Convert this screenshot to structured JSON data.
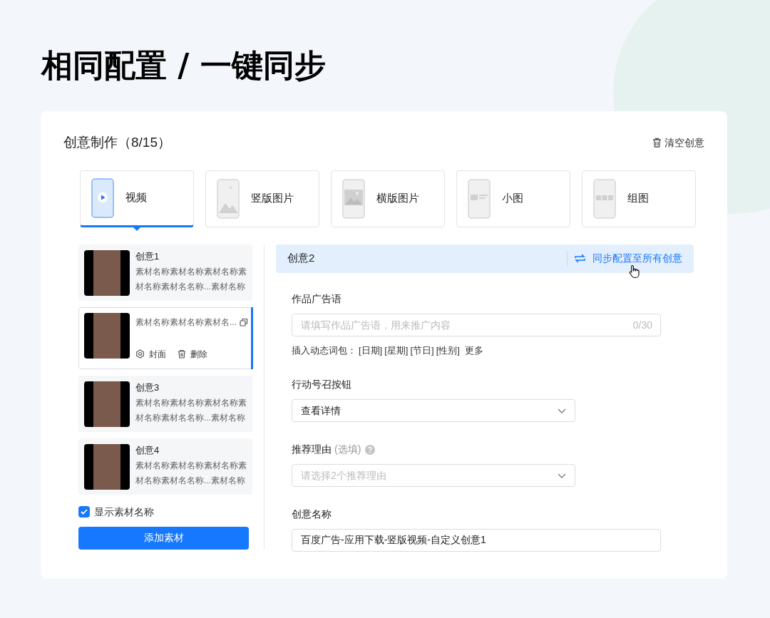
{
  "page_title": "相同配置 / 一键同步",
  "panel": {
    "title": "创意制作（8/15）",
    "clear_button": "清空创意"
  },
  "tabs": [
    {
      "label": "视频",
      "kind": "video",
      "selected": true
    },
    {
      "label": "竖版图片",
      "kind": "portrait",
      "selected": false
    },
    {
      "label": "横版图片",
      "kind": "landscape",
      "selected": false
    },
    {
      "label": "小图",
      "kind": "small",
      "selected": false
    },
    {
      "label": "组图",
      "kind": "group",
      "selected": false
    }
  ],
  "creatives": [
    {
      "title": "创意1",
      "description": "素材名称素材名称素材名称素材名称素材名名称...素材名称",
      "selected": false
    },
    {
      "description": "素材名称素材名称素材名...",
      "selected": true,
      "actions": [
        {
          "kind": "cover",
          "label": "封面"
        },
        {
          "kind": "delete",
          "label": "删除"
        }
      ]
    },
    {
      "title": "创意3",
      "description": "素材名称素材名称素材名称素材名称素材名名称...素材名称",
      "selected": false
    },
    {
      "title": "创意4",
      "description": "素材名称素材名称素材名称素材名称素材名名称...素材名称",
      "selected": false
    }
  ],
  "show_names": {
    "label": "显示素材名称",
    "checked": true
  },
  "add_button": "添加素材",
  "editor": {
    "title": "创意2",
    "sync_button": "同步配置至所有创意",
    "fields": [
      {
        "kind": "text",
        "label": "作品广告语",
        "placeholder": "请填写作品广告语，用来推广内容",
        "counter": "0/30",
        "insert_label": "插入动态词包：",
        "tokens": [
          "[日期]",
          "[星期]",
          "[节日]",
          "[性别]"
        ],
        "more": "更多"
      },
      {
        "kind": "select",
        "label": "行动号召按钮",
        "value": "查看详情"
      },
      {
        "kind": "select",
        "label": "推荐理由",
        "optional": "(选填)",
        "placeholder": "请选择2个推荐理由"
      },
      {
        "kind": "text",
        "label": "创意名称",
        "value": "百度广告-应用下载-竖版视频-自定义创意1"
      }
    ]
  }
}
